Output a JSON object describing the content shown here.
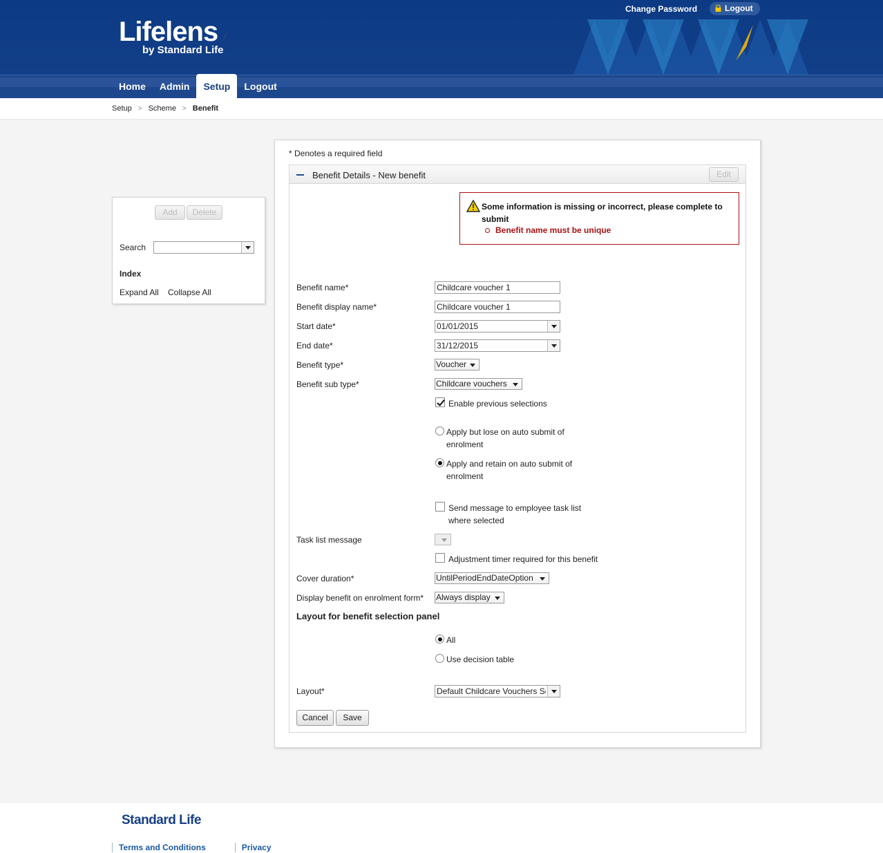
{
  "header": {
    "logo_name": "Lifelens",
    "logo_tagline": "by Standard Life",
    "change_password": "Change Password",
    "logout_pill": "Logout",
    "nav": [
      {
        "label": "Home"
      },
      {
        "label": "Admin"
      },
      {
        "label": "Setup"
      },
      {
        "label": "Logout"
      }
    ],
    "active_tab": "Setup"
  },
  "breadcrumb": [
    "Setup",
    "Scheme",
    "Benefit"
  ],
  "left_panel": {
    "add_label": "Add",
    "delete_label": "Delete",
    "search_label": "Search",
    "search_value": "",
    "index_label": "Index",
    "expand_all": "Expand All",
    "collapse_all": "Collapse All"
  },
  "form": {
    "required_note": "* Denotes a required field",
    "section_title": "Benefit Details - New benefit",
    "edit_label": "Edit",
    "error_message": "Some information is missing or incorrect, please complete to submit",
    "error_item": "Benefit name must be unique",
    "benefit_name_label": "Benefit name*",
    "benefit_name_value": "Childcare voucher 1",
    "display_name_label": "Benefit display name*",
    "display_name_value": "Childcare voucher 1",
    "start_date_label": "Start date*",
    "start_date_value": "01/01/2015",
    "end_date_label": "End date*",
    "end_date_value": "31/12/2015",
    "type_label": "Benefit type*",
    "type_value": "Voucher",
    "subtype_label": "Benefit sub type*",
    "subtype_value": "Childcare vouchers",
    "enable_prev_label": "Enable previous selections",
    "enable_prev_checked": true,
    "apply_lose_label": "Apply but lose on auto submit of enrolment",
    "apply_retain_label": "Apply and retain on auto submit of enrolment",
    "apply_choice": "retain",
    "send_message_label": "Send message to employee task list where selected",
    "send_message_checked": false,
    "task_list_label": "Task list message",
    "task_list_value": "",
    "adjustment_label": "Adjustment timer required for this benefit",
    "adjustment_checked": false,
    "cover_label": "Cover duration*",
    "cover_value": "UntilPeriodEndDateOption",
    "display_benefit_label": "Display benefit on enrolment form*",
    "display_benefit_value": "Always display",
    "layout_heading": "Layout for benefit selection panel",
    "layout_all_label": "All",
    "layout_decision_label": "Use decision table",
    "layout_choice": "All",
    "layout_label": "Layout*",
    "layout_value": "Default Childcare Vouchers Sc",
    "cancel_label": "Cancel",
    "save_label": "Save"
  },
  "footer": {
    "logo": "Standard Life",
    "terms": "Terms and Conditions",
    "privacy": "Privacy"
  },
  "colors": {
    "header_blue": "#0f3c86",
    "accent_yellow": "#f7b500",
    "error_red": "#aa1111",
    "link_blue": "#1a5aa6"
  }
}
